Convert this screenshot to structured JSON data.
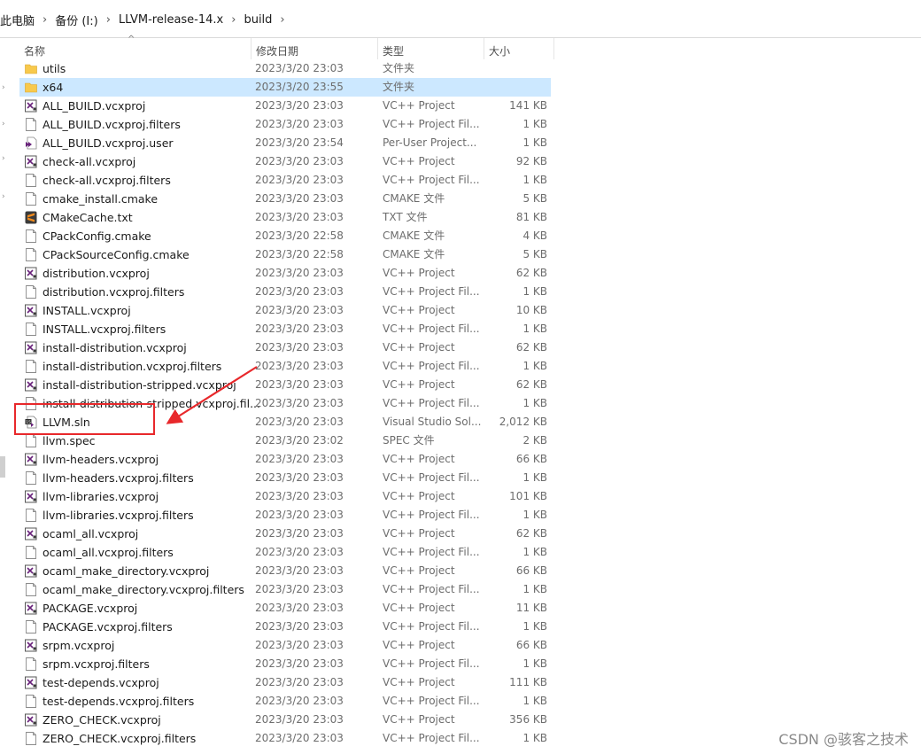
{
  "breadcrumb": [
    "此电脑",
    "备份 (I:)",
    "LLVM-release-14.x",
    "build"
  ],
  "columns": {
    "name": "名称",
    "date": "修改日期",
    "type": "类型",
    "size": "大小"
  },
  "files": [
    {
      "name": "utils",
      "date": "2023/3/20 23:03",
      "type": "文件夹",
      "size": "",
      "icon": "folder-icon",
      "selected": false
    },
    {
      "name": "x64",
      "date": "2023/3/20 23:55",
      "type": "文件夹",
      "size": "",
      "icon": "folder-icon",
      "selected": true
    },
    {
      "name": "ALL_BUILD.vcxproj",
      "date": "2023/3/20 23:03",
      "type": "VC++ Project",
      "size": "141 KB",
      "icon": "vcxproj-icon",
      "selected": false
    },
    {
      "name": "ALL_BUILD.vcxproj.filters",
      "date": "2023/3/20 23:03",
      "type": "VC++ Project Fil...",
      "size": "1 KB",
      "icon": "file-icon",
      "selected": false
    },
    {
      "name": "ALL_BUILD.vcxproj.user",
      "date": "2023/3/20 23:54",
      "type": "Per-User Project...",
      "size": "1 KB",
      "icon": "vs-user-icon",
      "selected": false
    },
    {
      "name": "check-all.vcxproj",
      "date": "2023/3/20 23:03",
      "type": "VC++ Project",
      "size": "92 KB",
      "icon": "vcxproj-icon",
      "selected": false
    },
    {
      "name": "check-all.vcxproj.filters",
      "date": "2023/3/20 23:03",
      "type": "VC++ Project Fil...",
      "size": "1 KB",
      "icon": "file-icon",
      "selected": false
    },
    {
      "name": "cmake_install.cmake",
      "date": "2023/3/20 23:03",
      "type": "CMAKE 文件",
      "size": "5 KB",
      "icon": "file-icon",
      "selected": false
    },
    {
      "name": "CMakeCache.txt",
      "date": "2023/3/20 23:03",
      "type": "TXT 文件",
      "size": "81 KB",
      "icon": "sublime-icon",
      "selected": false
    },
    {
      "name": "CPackConfig.cmake",
      "date": "2023/3/20 22:58",
      "type": "CMAKE 文件",
      "size": "4 KB",
      "icon": "file-icon",
      "selected": false
    },
    {
      "name": "CPackSourceConfig.cmake",
      "date": "2023/3/20 22:58",
      "type": "CMAKE 文件",
      "size": "5 KB",
      "icon": "file-icon",
      "selected": false
    },
    {
      "name": "distribution.vcxproj",
      "date": "2023/3/20 23:03",
      "type": "VC++ Project",
      "size": "62 KB",
      "icon": "vcxproj-icon",
      "selected": false
    },
    {
      "name": "distribution.vcxproj.filters",
      "date": "2023/3/20 23:03",
      "type": "VC++ Project Fil...",
      "size": "1 KB",
      "icon": "file-icon",
      "selected": false
    },
    {
      "name": "INSTALL.vcxproj",
      "date": "2023/3/20 23:03",
      "type": "VC++ Project",
      "size": "10 KB",
      "icon": "vcxproj-icon",
      "selected": false
    },
    {
      "name": "INSTALL.vcxproj.filters",
      "date": "2023/3/20 23:03",
      "type": "VC++ Project Fil...",
      "size": "1 KB",
      "icon": "file-icon",
      "selected": false
    },
    {
      "name": "install-distribution.vcxproj",
      "date": "2023/3/20 23:03",
      "type": "VC++ Project",
      "size": "62 KB",
      "icon": "vcxproj-icon",
      "selected": false
    },
    {
      "name": "install-distribution.vcxproj.filters",
      "date": "2023/3/20 23:03",
      "type": "VC++ Project Fil...",
      "size": "1 KB",
      "icon": "file-icon",
      "selected": false
    },
    {
      "name": "install-distribution-stripped.vcxproj",
      "date": "2023/3/20 23:03",
      "type": "VC++ Project",
      "size": "62 KB",
      "icon": "vcxproj-icon",
      "selected": false
    },
    {
      "name": "install-distribution-stripped.vcxproj.fil...",
      "date": "2023/3/20 23:03",
      "type": "VC++ Project Fil...",
      "size": "1 KB",
      "icon": "file-icon",
      "selected": false
    },
    {
      "name": "LLVM.sln",
      "date": "2023/3/20 23:03",
      "type": "Visual Studio Sol...",
      "size": "2,012 KB",
      "icon": "vs-solution-icon",
      "selected": false
    },
    {
      "name": "llvm.spec",
      "date": "2023/3/20 23:02",
      "type": "SPEC 文件",
      "size": "2 KB",
      "icon": "file-icon",
      "selected": false
    },
    {
      "name": "llvm-headers.vcxproj",
      "date": "2023/3/20 23:03",
      "type": "VC++ Project",
      "size": "66 KB",
      "icon": "vcxproj-icon",
      "selected": false
    },
    {
      "name": "llvm-headers.vcxproj.filters",
      "date": "2023/3/20 23:03",
      "type": "VC++ Project Fil...",
      "size": "1 KB",
      "icon": "file-icon",
      "selected": false
    },
    {
      "name": "llvm-libraries.vcxproj",
      "date": "2023/3/20 23:03",
      "type": "VC++ Project",
      "size": "101 KB",
      "icon": "vcxproj-icon",
      "selected": false
    },
    {
      "name": "llvm-libraries.vcxproj.filters",
      "date": "2023/3/20 23:03",
      "type": "VC++ Project Fil...",
      "size": "1 KB",
      "icon": "file-icon",
      "selected": false
    },
    {
      "name": "ocaml_all.vcxproj",
      "date": "2023/3/20 23:03",
      "type": "VC++ Project",
      "size": "62 KB",
      "icon": "vcxproj-icon",
      "selected": false
    },
    {
      "name": "ocaml_all.vcxproj.filters",
      "date": "2023/3/20 23:03",
      "type": "VC++ Project Fil...",
      "size": "1 KB",
      "icon": "file-icon",
      "selected": false
    },
    {
      "name": "ocaml_make_directory.vcxproj",
      "date": "2023/3/20 23:03",
      "type": "VC++ Project",
      "size": "66 KB",
      "icon": "vcxproj-icon",
      "selected": false
    },
    {
      "name": "ocaml_make_directory.vcxproj.filters",
      "date": "2023/3/20 23:03",
      "type": "VC++ Project Fil...",
      "size": "1 KB",
      "icon": "file-icon",
      "selected": false
    },
    {
      "name": "PACKAGE.vcxproj",
      "date": "2023/3/20 23:03",
      "type": "VC++ Project",
      "size": "11 KB",
      "icon": "vcxproj-icon",
      "selected": false
    },
    {
      "name": "PACKAGE.vcxproj.filters",
      "date": "2023/3/20 23:03",
      "type": "VC++ Project Fil...",
      "size": "1 KB",
      "icon": "file-icon",
      "selected": false
    },
    {
      "name": "srpm.vcxproj",
      "date": "2023/3/20 23:03",
      "type": "VC++ Project",
      "size": "66 KB",
      "icon": "vcxproj-icon",
      "selected": false
    },
    {
      "name": "srpm.vcxproj.filters",
      "date": "2023/3/20 23:03",
      "type": "VC++ Project Fil...",
      "size": "1 KB",
      "icon": "file-icon",
      "selected": false
    },
    {
      "name": "test-depends.vcxproj",
      "date": "2023/3/20 23:03",
      "type": "VC++ Project",
      "size": "111 KB",
      "icon": "vcxproj-icon",
      "selected": false
    },
    {
      "name": "test-depends.vcxproj.filters",
      "date": "2023/3/20 23:03",
      "type": "VC++ Project Fil...",
      "size": "1 KB",
      "icon": "file-icon",
      "selected": false
    },
    {
      "name": "ZERO_CHECK.vcxproj",
      "date": "2023/3/20 23:03",
      "type": "VC++ Project",
      "size": "356 KB",
      "icon": "vcxproj-icon",
      "selected": false
    },
    {
      "name": "ZERO_CHECK.vcxproj.filters",
      "date": "2023/3/20 23:03",
      "type": "VC++ Project Fil...",
      "size": "1 KB",
      "icon": "file-icon",
      "selected": false
    }
  ],
  "annotation": {
    "color": "#e8282b",
    "target": "LLVM.sln"
  },
  "watermark": "CSDN @骇客之技术",
  "colors": {
    "selection": "#cce8ff",
    "folder": "#f8c94c",
    "vs_purple": "#68217a",
    "sublime_orange": "#f28b1d"
  }
}
